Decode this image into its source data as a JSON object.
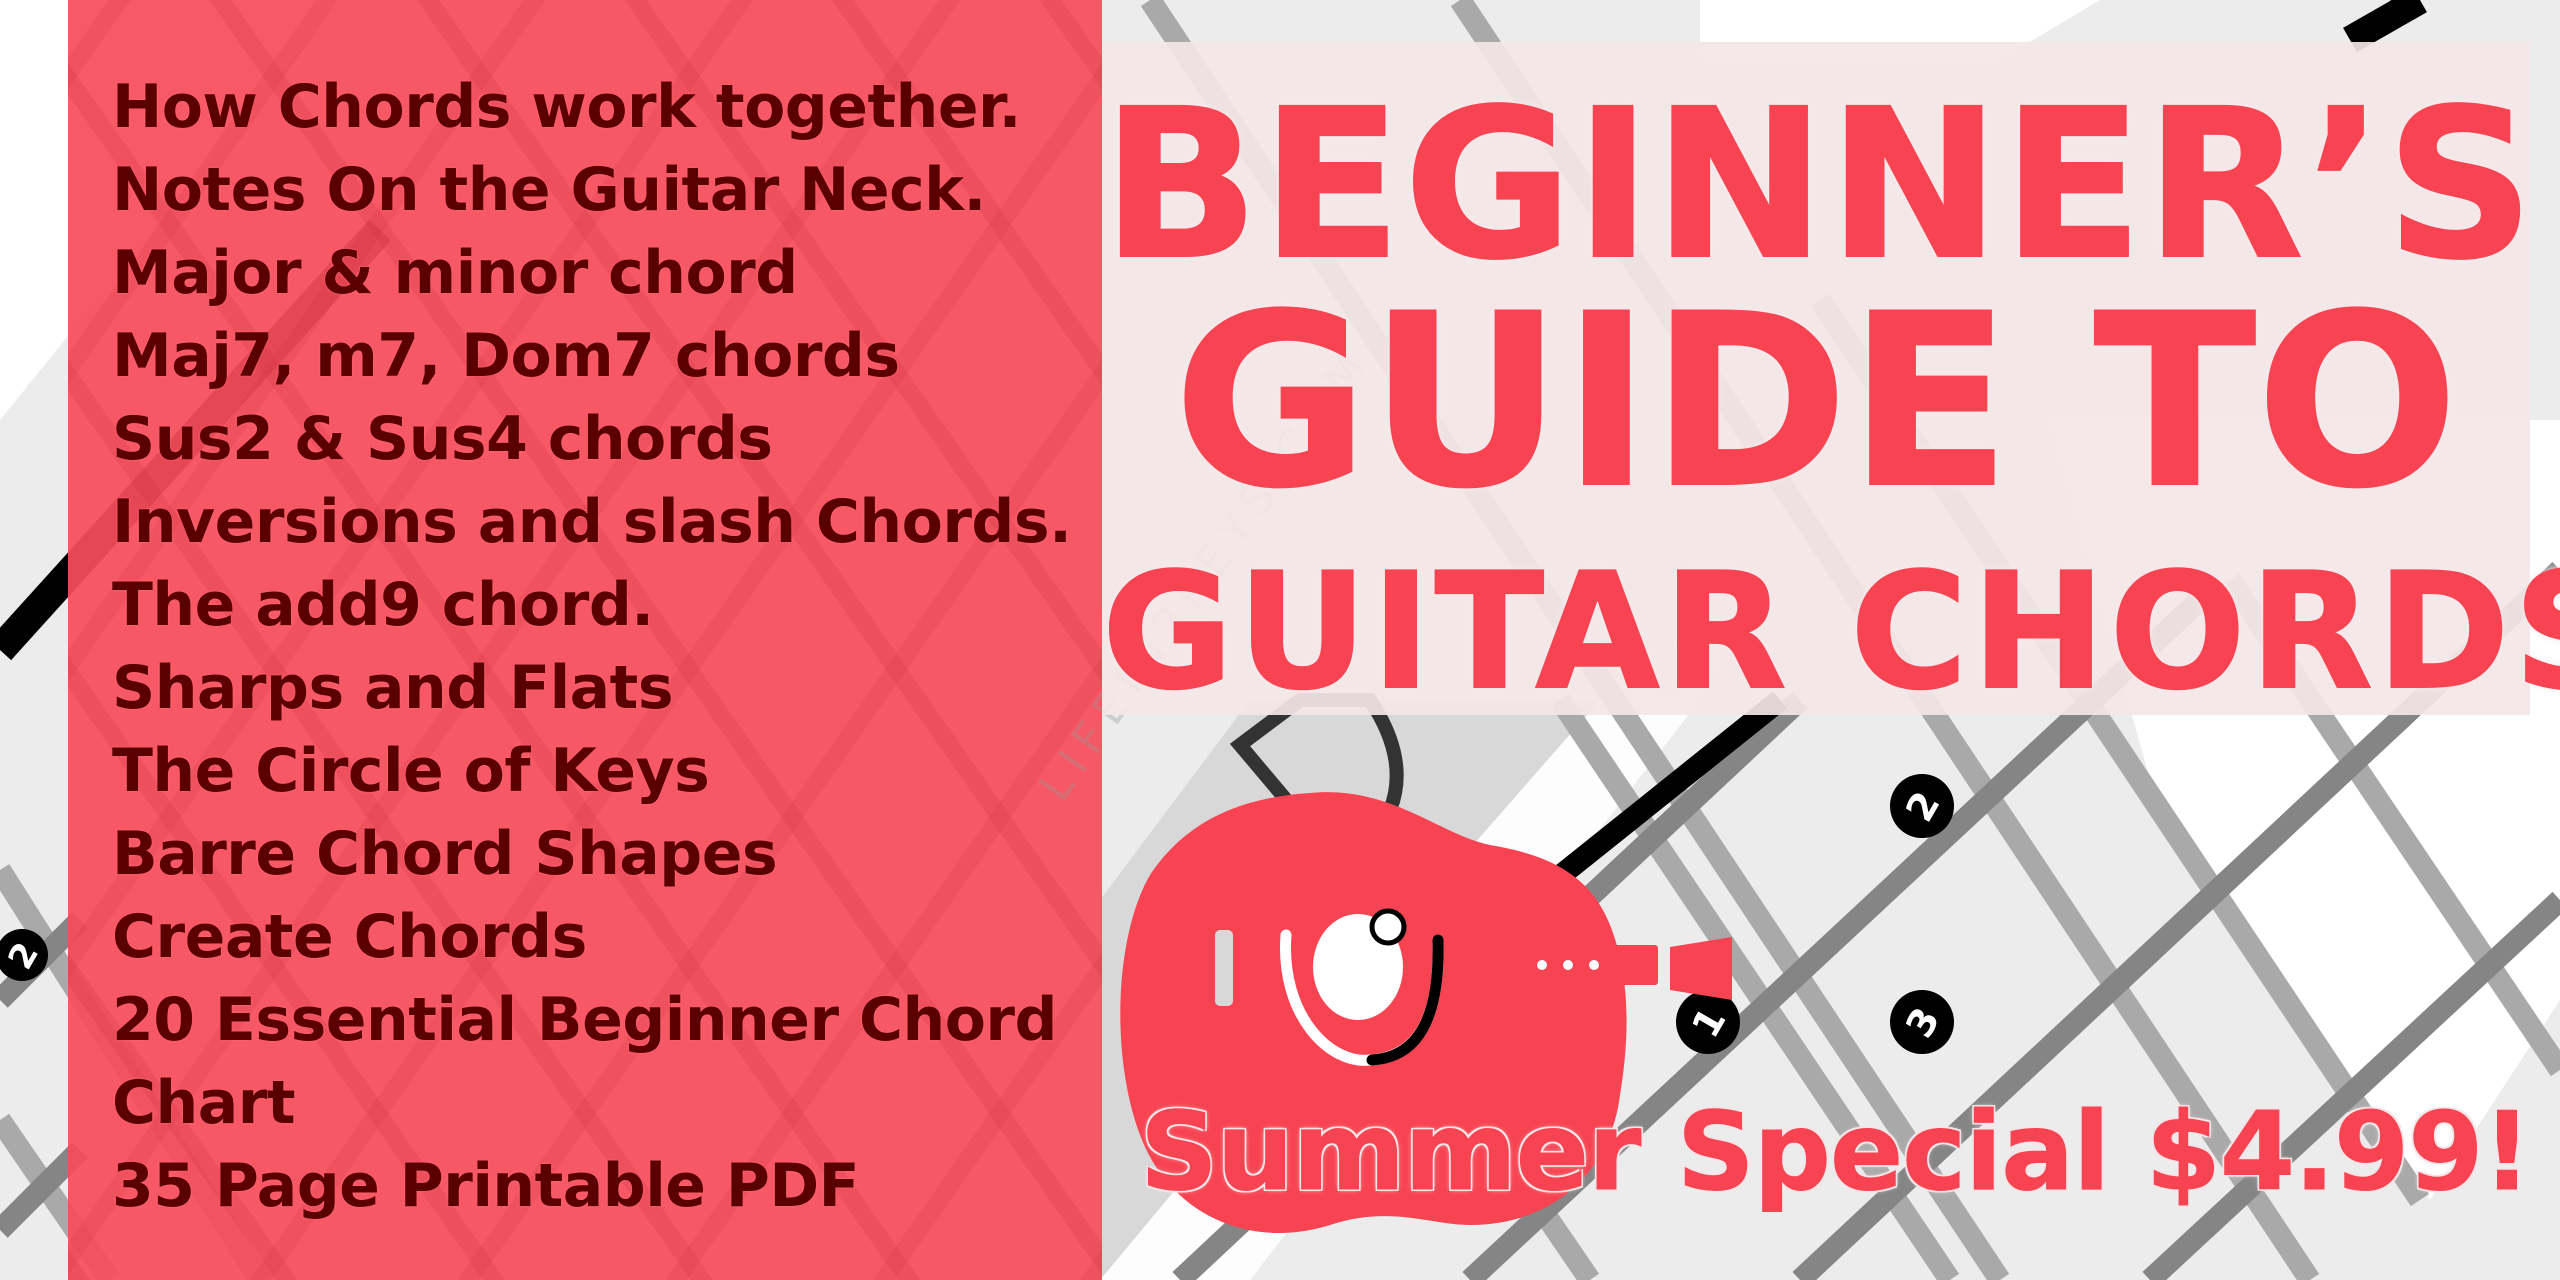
{
  "feature_list": {
    "items": [
      "How Chords work together.",
      "Notes On the Guitar Neck.",
      "Major & minor chord",
      "Maj7, m7, Dom7 chords",
      "Sus2 & Sus4 chords",
      "Inversions and slash Chords.",
      "The add9 chord.",
      "Sharps and Flats",
      "The Circle of Keys",
      "Barre Chord Shapes",
      "Create Chords",
      "20 Essential Beginner Chord",
      "Chart",
      "35 Page Printable PDF"
    ]
  },
  "title": {
    "line1": "BEGINNER’S",
    "line2": "GUIDE TO",
    "line3": "GUITAR CHORDS"
  },
  "promo": {
    "price_text": "Summer Special $4.99!"
  },
  "background": {
    "fret_markers": [
      "2",
      "1",
      "2",
      "3"
    ],
    "watermark": "LIFEIN2KEYS.COM"
  },
  "icons": {
    "guitar": "guitar-icon"
  },
  "colors": {
    "brand_red": "#f84452",
    "list_text": "#5a0000",
    "panel_red": "#f84c5a",
    "title_box": "#f4e6e7"
  }
}
